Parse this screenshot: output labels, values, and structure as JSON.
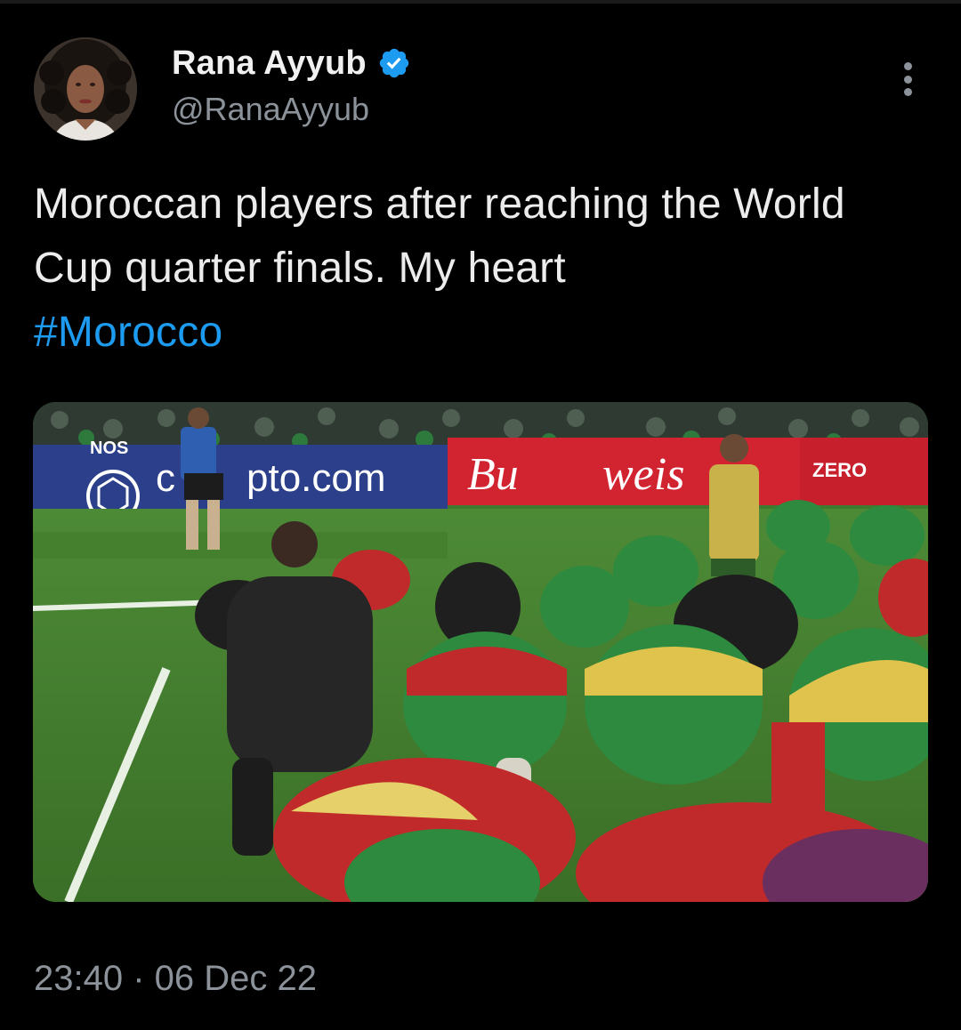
{
  "tweet": {
    "author": {
      "display_name": "Rana Ayyub",
      "handle": "@RanaAyyub",
      "verified": true,
      "avatar_icon": "avatar-photo"
    },
    "text_main": "Moroccan players after reaching the World Cup quarter finals. My heart",
    "hashtag": "#Morocco",
    "timestamp": "23:40 · 06 Dec 22",
    "more_icon": "more-vertical-icon",
    "media": {
      "kind": "photo",
      "broadcaster_watermark": "NOS",
      "ad_boards": [
        "crypto.com",
        "Budweiser",
        "ZERO"
      ]
    }
  },
  "colors": {
    "background": "#000000",
    "text": "#e7e9ea",
    "secondary_text": "#8b9299",
    "link": "#1d9bf0",
    "verified_badge": "#1d9bf0"
  }
}
